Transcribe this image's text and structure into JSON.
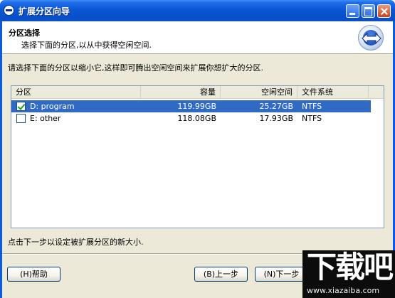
{
  "window": {
    "title": "扩展分区向导"
  },
  "header": {
    "title": "分区选择",
    "subtitle": "选择下面的分区,以从中获得空闲空间."
  },
  "instruction": "请选择下面的分区以缩小它,这样即可腾出空闲空间来扩展你想扩大的分区.",
  "table": {
    "columns": [
      "分区",
      "容量",
      "空闲空间",
      "文件系统"
    ],
    "rows": [
      {
        "checked": true,
        "name": "D: program",
        "capacity": "119.99GB",
        "free": "25.27GB",
        "fs": "NTFS"
      },
      {
        "checked": false,
        "name": "E: other",
        "capacity": "118.08GB",
        "free": "17.93GB",
        "fs": "NTFS"
      }
    ]
  },
  "hint": "点击下一步以设定被扩展分区的新大小.",
  "buttons": {
    "help": "(H)帮助",
    "back": "(B)上一步",
    "next": "(N)下一步"
  },
  "watermark": {
    "main": "下载吧",
    "url": "www.xiazaiba.com"
  },
  "colors": {
    "title_bar": "#0a57d6",
    "selection": "#316ac5",
    "dialog_bg": "#ece9d8"
  }
}
